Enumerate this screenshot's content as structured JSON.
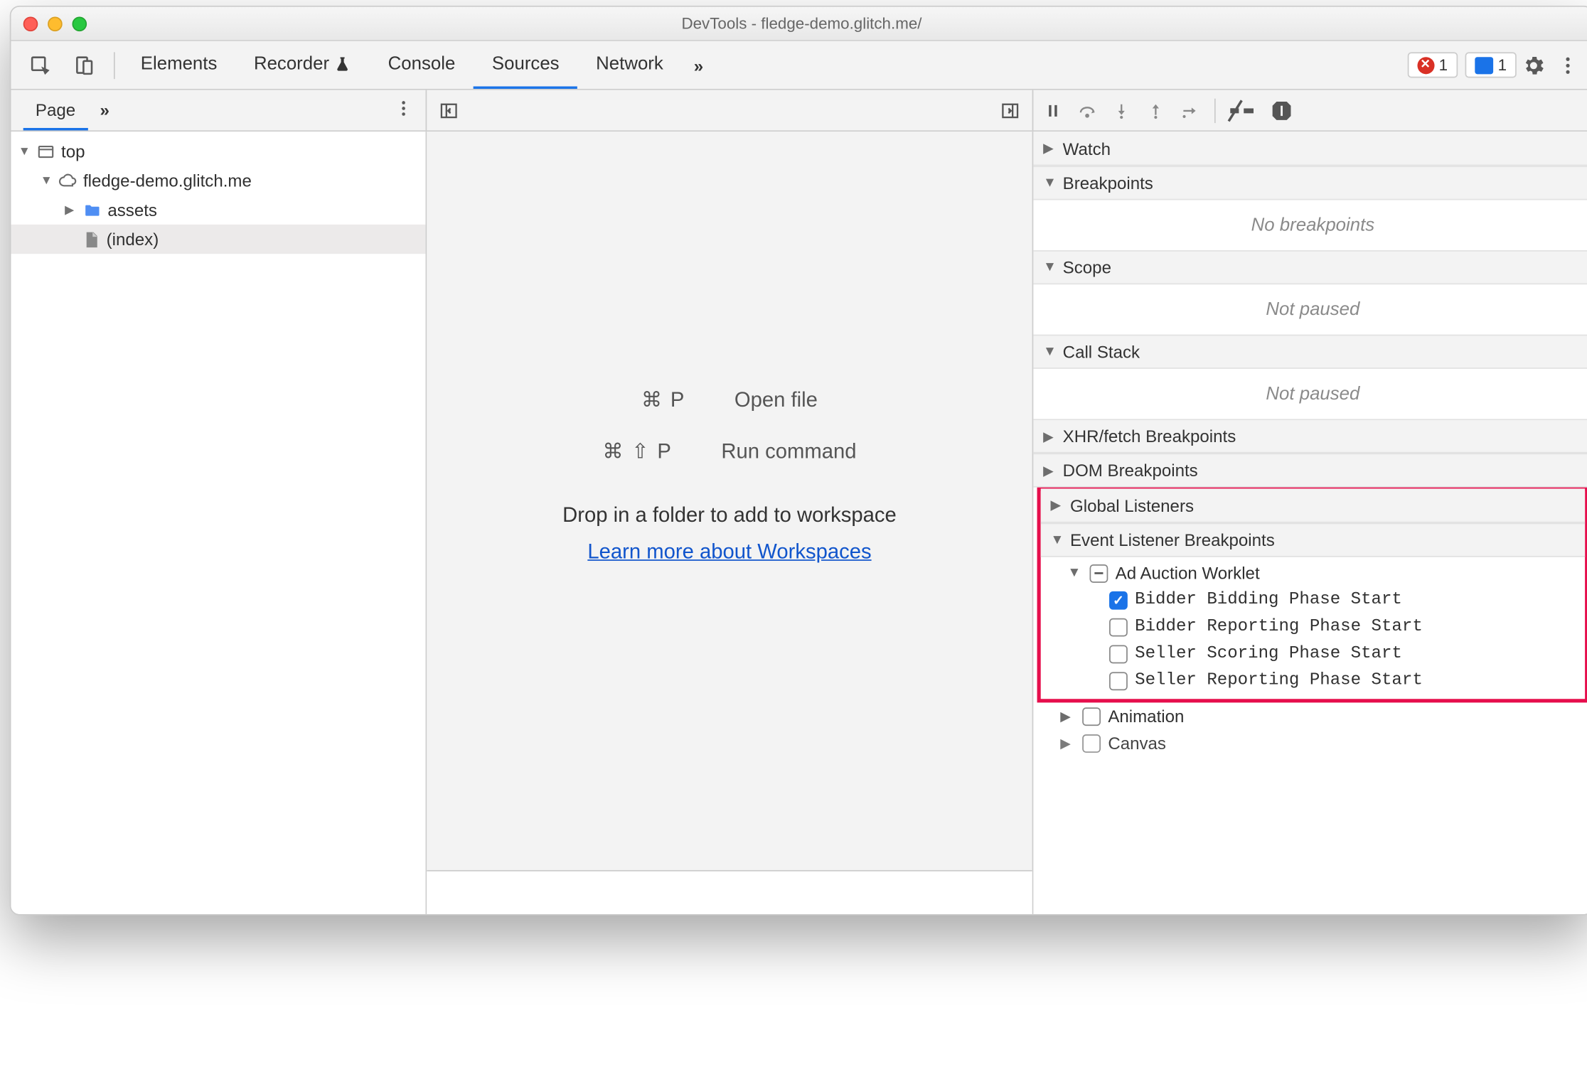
{
  "window": {
    "title": "DevTools - fledge-demo.glitch.me/"
  },
  "mainTabs": {
    "items": [
      "Elements",
      "Recorder",
      "Console",
      "Sources",
      "Network"
    ],
    "moreIndicator": "»"
  },
  "statusPills": {
    "errorCount": "1",
    "messageCount": "1"
  },
  "pageTabs": {
    "active": "Page",
    "more": "»"
  },
  "navTree": {
    "top": "top",
    "origin": "fledge-demo.glitch.me",
    "folder": "assets",
    "file": "(index)"
  },
  "editor": {
    "openFileKbd": "⌘ P",
    "openFileLabel": "Open file",
    "runCmdKbd": "⌘ ⇧ P",
    "runCmdLabel": "Run command",
    "dropHint": "Drop in a folder to add to workspace",
    "workspacesLink": "Learn more about Workspaces"
  },
  "rightPane": {
    "sections": {
      "watch": "Watch",
      "breakpoints": "Breakpoints",
      "breakpointsEmpty": "No breakpoints",
      "scope": "Scope",
      "scopeEmpty": "Not paused",
      "callStack": "Call Stack",
      "callStackEmpty": "Not paused",
      "xhr": "XHR/fetch Breakpoints",
      "dom": "DOM Breakpoints",
      "global": "Global Listeners",
      "eventListener": "Event Listener Breakpoints"
    },
    "adAuction": {
      "group": "Ad Auction Worklet",
      "items": [
        {
          "label": "Bidder Bidding Phase Start",
          "checked": true
        },
        {
          "label": "Bidder Reporting Phase Start",
          "checked": false
        },
        {
          "label": "Seller Scoring Phase Start",
          "checked": false
        },
        {
          "label": "Seller Reporting Phase Start",
          "checked": false
        }
      ]
    },
    "animationGroup": "Animation",
    "canvasGroup": "Canvas"
  }
}
